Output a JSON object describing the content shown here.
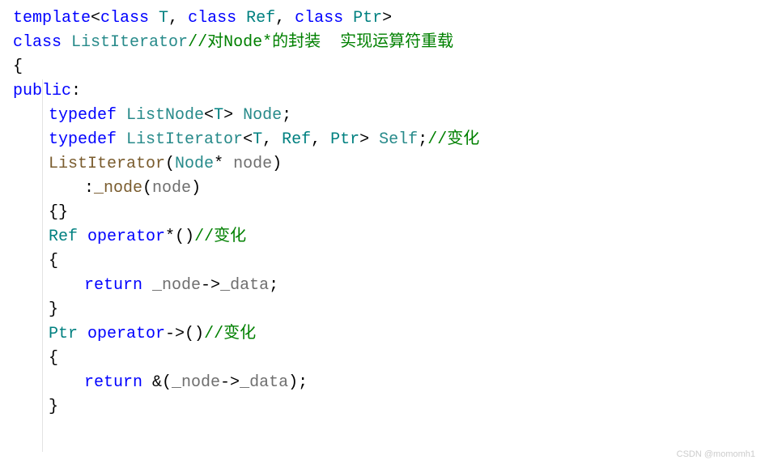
{
  "code": {
    "l1_template": "template",
    "l1_open": "<",
    "l1_class1": "class",
    "l1_T": " T",
    "l1_c1": ", ",
    "l1_class2": "class",
    "l1_Ref": " Ref",
    "l1_c2": ", ",
    "l1_class3": "class",
    "l1_Ptr": " Ptr",
    "l1_close": ">",
    "l2_class": "class",
    "l2_sp": " ",
    "l2_ListIterator": "ListIterator",
    "l2_comment": "//对Node*的封装  实现运算符重载",
    "l3": "{",
    "l4_public": "public",
    "l4_colon": ":",
    "l5_typedef": "typedef",
    "l5_sp1": " ",
    "l5_ListNode": "ListNode",
    "l5_open": "<",
    "l5_T": "T",
    "l5_close": "> ",
    "l5_Node": "Node",
    "l5_semi": ";",
    "l6_typedef": "typedef",
    "l6_sp1": " ",
    "l6_ListIterator": "ListIterator",
    "l6_open": "<",
    "l6_T": "T",
    "l6_c1": ", ",
    "l6_Ref": "Ref",
    "l6_c2": ", ",
    "l6_Ptr": "Ptr",
    "l6_close": "> ",
    "l6_Self": "Self",
    "l6_semi": ";",
    "l6_comment": "//变化",
    "l7_ListIterator": "ListIterator",
    "l7_open": "(",
    "l7_Node": "Node",
    "l7_star": "* ",
    "l7_node": "node",
    "l7_close": ")",
    "l8_colon": ":",
    "l8_node": "_node",
    "l8_open": "(",
    "l8_nodep": "node",
    "l8_close": ")",
    "l9": "{}",
    "l10_Ref": "Ref",
    "l10_sp": " ",
    "l10_operator": "operator",
    "l10_star": "*()",
    "l10_comment": "//变化",
    "l11": "{",
    "l12_return": "return",
    "l12_sp": " ",
    "l12_node": "_node",
    "l12_arrow": "->",
    "l12_data": "_data",
    "l12_semi": ";",
    "l13": "}",
    "l14_Ptr": "Ptr",
    "l14_sp": " ",
    "l14_operator": "operator",
    "l14_arrow": "->()",
    "l14_comment": "//变化",
    "l15": "{",
    "l16_return": "return",
    "l16_sp": " &(",
    "l16_node": "_node",
    "l16_arrow": "->",
    "l16_data": "_data",
    "l16_close": ");",
    "l17": "}"
  },
  "watermark": "CSDN @momomh1"
}
